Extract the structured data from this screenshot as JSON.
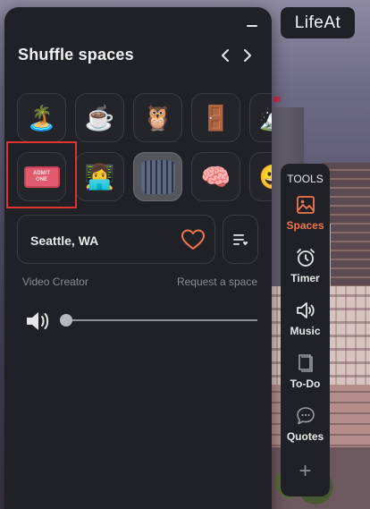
{
  "app": {
    "logo_text": "LifeAt"
  },
  "panel": {
    "title": "Shuffle spaces",
    "spaces_row1": [
      {
        "icon": "island-icon",
        "glyph": "🏝️"
      },
      {
        "icon": "coffee-icon",
        "glyph": "☕"
      },
      {
        "icon": "owl-icon",
        "glyph": "🦉"
      },
      {
        "icon": "door-icon",
        "glyph": "🚪"
      },
      {
        "icon": "mountain-icon",
        "glyph": "🏔️"
      }
    ],
    "spaces_row2": [
      {
        "icon": "ticket-icon",
        "ticket_text": [
          "ADMIT",
          "ONE"
        ]
      },
      {
        "icon": "technologist-icon",
        "glyph": "👩‍💻"
      },
      {
        "icon": "city-icon",
        "selected": true
      },
      {
        "icon": "brain-icon",
        "glyph": "🧠"
      },
      {
        "icon": "emoji-face-icon",
        "glyph": "😀"
      }
    ],
    "location": "Seattle, WA",
    "video_creator_label": "Video Creator",
    "request_space_label": "Request a space",
    "volume_level": 0
  },
  "tools": {
    "header": "TOOLS",
    "items": [
      {
        "label": "Spaces",
        "icon": "image-icon",
        "active": true
      },
      {
        "label": "Timer",
        "icon": "alarm-clock-icon",
        "active": false
      },
      {
        "label": "Music",
        "icon": "speaker-icon",
        "active": false
      },
      {
        "label": "To-Do",
        "icon": "notebook-icon",
        "active": false
      },
      {
        "label": "Quotes",
        "icon": "chat-bubble-icon",
        "active": false
      }
    ],
    "add_glyph": "+"
  },
  "colors": {
    "panel_bg": "#1f2126",
    "accent": "#f2764b",
    "highlight_border": "#e3312f"
  }
}
